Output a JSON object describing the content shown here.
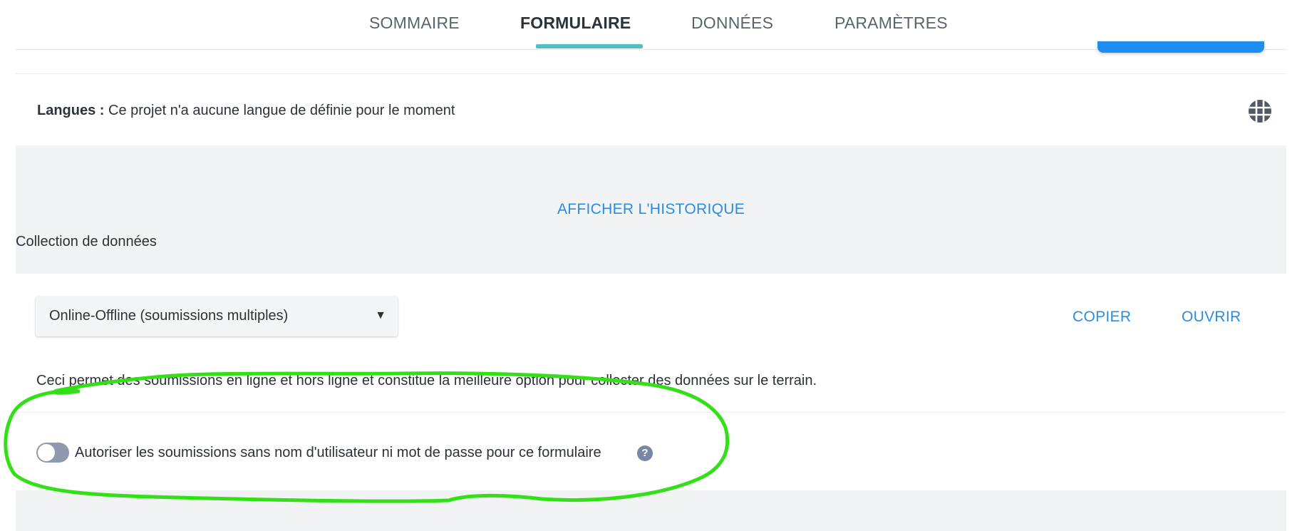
{
  "tabs": [
    {
      "label": "SOMMAIRE"
    },
    {
      "label": "FORMULAIRE",
      "active": true
    },
    {
      "label": "DONNÉES"
    },
    {
      "label": "PARAMÈTRES"
    }
  ],
  "languages": {
    "label": "Langues :",
    "text": "Ce projet n'a aucune langue de définie pour le moment",
    "icon": "globe-icon"
  },
  "history": {
    "label": "AFFICHER L'HISTORIQUE"
  },
  "collection": {
    "label": "Collection de données",
    "select_value": "Online-Offline (soumissions multiples)",
    "copy_label": "COPIER",
    "open_label": "OUVRIR",
    "description": "Ceci permet des soumissions en ligne et hors ligne et constitue la meilleure option pour collecter des données sur le terrain.",
    "toggle_label": "Autoriser les soumissions sans nom d'utilisateur ni mot de passe pour ce formulaire",
    "toggle_on": false,
    "help_glyph": "?"
  },
  "colors": {
    "accent_tab": "#4fc0c8",
    "link": "#2b8ce0",
    "annotation": "#33e017"
  }
}
